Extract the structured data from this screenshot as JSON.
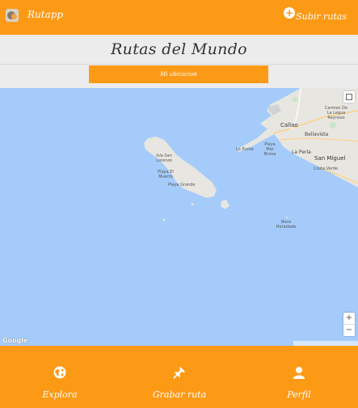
{
  "header": {
    "logo_icon": "app-logo",
    "app_name": "Rutapp",
    "upload_label": "Subir rutas",
    "upload_icon": "plus-circle-icon",
    "accent_color": "#fc9a16"
  },
  "title_section": {
    "title": "Rutas del Mundo",
    "location_button": "Mi ubicacion"
  },
  "map": {
    "labels": {
      "callao": "Callao",
      "la_punta": "La Punta",
      "playa_mar_brava": "Playa Mar Brava",
      "bellavista": "Bellavista",
      "carmen_de_la_legua": "Carmen De La Legua Reynoso",
      "la_perla": "La Perla",
      "san_miguel": "San Miguel",
      "costa_verde": "Costa Verde",
      "isla_san_lorenzo": "Isla San Lorenzo",
      "playa_el_muerto": "Playa El Muerto",
      "playa_grande": "Playa Grande",
      "roca_horadada": "Roca Horadada"
    },
    "attribution": "Google",
    "zoom_in": "+",
    "zoom_out": "−",
    "water_color": "#a4cbfa",
    "land_color": "#e8e6e1"
  },
  "nav": {
    "items": [
      {
        "label": "Explora",
        "icon": "globe-icon"
      },
      {
        "label": "Grabar ruta",
        "icon": "pin-icon"
      },
      {
        "label": "Perfil",
        "icon": "user-icon"
      }
    ]
  }
}
